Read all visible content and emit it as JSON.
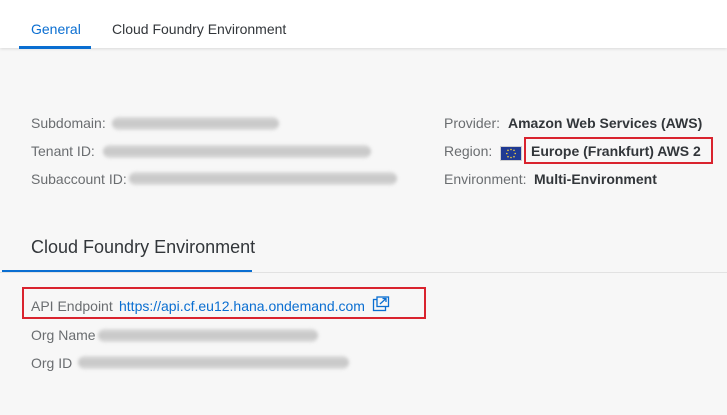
{
  "tabs": [
    {
      "label": "General"
    },
    {
      "label": "Cloud Foundry Environment"
    }
  ],
  "general": {
    "subdomain_label": "Subdomain:",
    "tenant_label": "Tenant ID:",
    "subaccount_label": "Subaccount ID:",
    "provider_label": "Provider:",
    "provider_value": "Amazon Web Services (AWS)",
    "region_label": "Region:",
    "region_value": "Europe (Frankfurt) AWS 2",
    "environment_label": "Environment:",
    "environment_value": "Multi-Environment"
  },
  "cf": {
    "section_title": "Cloud Foundry Environment",
    "api_label": "API Endpoint",
    "api_value": "https://api.cf.eu12.hana.ondemand.com",
    "org_name_label": "Org Name",
    "org_id_label": "Org ID"
  },
  "icons": {
    "flag": "eu-flag-icon",
    "external_link": "external-link-icon"
  },
  "colors": {
    "accent": "#0a6ed1",
    "highlight": "#d9232e"
  }
}
